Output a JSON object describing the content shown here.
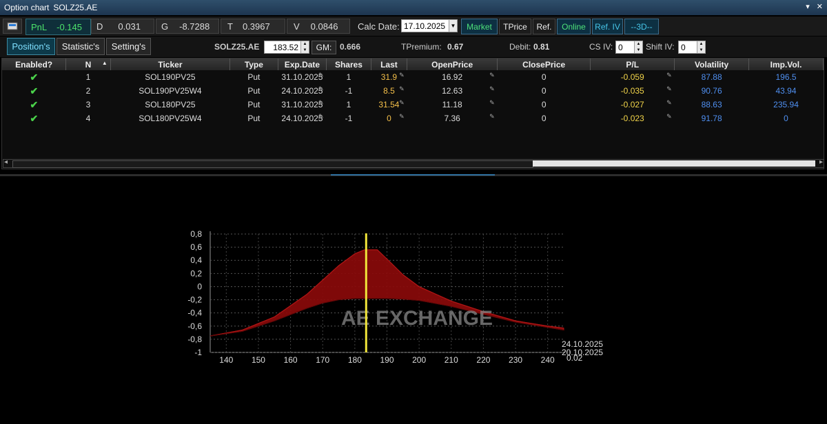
{
  "window": {
    "title": "Option chart",
    "symbol": "SOLZ25.AE",
    "pin": "▾",
    "close": "✕"
  },
  "toolbar": {
    "pnl_label": "PnL",
    "pnl_value": "-0.145",
    "greeks": [
      {
        "label": "D",
        "value": "0.031"
      },
      {
        "label": "G",
        "value": "-8.7288"
      },
      {
        "label": "T",
        "value": "0.3967"
      },
      {
        "label": "V",
        "value": "0.0846"
      }
    ],
    "calc_date_label": "Calc Date:",
    "calc_date_value": "17.10.2025",
    "buttons": [
      "Market",
      "TPrice",
      "Ref.",
      "Online",
      "Ref. IV",
      "--3D--"
    ]
  },
  "tabs": [
    "Position's",
    "Statistic's",
    "Setting's"
  ],
  "row2": {
    "symbol": "SOLZ25.AE",
    "price": "183.52",
    "gm_label": "GM:",
    "gm_value": "0.666",
    "tpremium_label": "TPremium:",
    "tpremium_value": "0.67",
    "debit_label": "Debit:",
    "debit_value": "0.81",
    "cs_iv_label": "CS IV:",
    "cs_iv_value": "0",
    "shift_iv_label": "Shift IV:",
    "shift_iv_value": "0"
  },
  "table": {
    "columns": [
      "Enabled?",
      "N",
      "Ticker",
      "Type",
      "Exp.Date",
      "Shares",
      "Last",
      "OpenPrice",
      "ClosePrice",
      "P/L",
      "Volatility",
      "Imp.Vol."
    ],
    "rows": [
      {
        "enabled": "✔",
        "n": "1",
        "ticker": "SOL190PV25",
        "type": "Put",
        "exp": "31.10.2025",
        "shares": "1",
        "last": "31.9",
        "open": "16.92",
        "close": "0",
        "pl": "-0.059",
        "vol": "87.88",
        "iv": "196.5"
      },
      {
        "enabled": "✔",
        "n": "2",
        "ticker": "SOL190PV25W4",
        "type": "Put",
        "exp": "24.10.2025",
        "shares": "-1",
        "last": "8.5",
        "open": "12.63",
        "close": "0",
        "pl": "-0.035",
        "vol": "90.76",
        "iv": "43.94"
      },
      {
        "enabled": "✔",
        "n": "3",
        "ticker": "SOL180PV25",
        "type": "Put",
        "exp": "31.10.2025",
        "shares": "1",
        "last": "31.54",
        "open": "11.18",
        "close": "0",
        "pl": "-0.027",
        "vol": "88.63",
        "iv": "235.94"
      },
      {
        "enabled": "✔",
        "n": "4",
        "ticker": "SOL180PV25W4",
        "type": "Put",
        "exp": "24.10.2025",
        "shares": "-1",
        "last": "0",
        "open": "7.36",
        "close": "0",
        "pl": "-0.023",
        "vol": "91.78",
        "iv": "0"
      }
    ]
  },
  "chart_data": {
    "type": "area",
    "watermark": "AE EXCHANGE",
    "y_ticks": [
      "0,8",
      "0,6",
      "0,4",
      "0,2",
      "0",
      "-0,2",
      "-0,4",
      "-0,6",
      "-0,8",
      "-1"
    ],
    "x_ticks": [
      "140",
      "150",
      "160",
      "170",
      "180",
      "190",
      "200",
      "210",
      "220",
      "230",
      "240"
    ],
    "depth_labels": [
      "24.10.2025",
      "…",
      "20.10.2025",
      "0.02"
    ],
    "ylim": [
      -1,
      0.8
    ],
    "xlim": [
      135,
      245
    ],
    "current_price": 183.52,
    "upper_series": {
      "x": [
        135,
        145,
        155,
        165,
        170,
        175,
        180,
        183,
        187,
        190,
        195,
        200,
        210,
        220,
        230,
        240,
        245
      ],
      "y": [
        -0.75,
        -0.66,
        -0.46,
        -0.12,
        0.1,
        0.32,
        0.5,
        0.56,
        0.56,
        0.42,
        0.18,
        0.0,
        -0.22,
        -0.38,
        -0.52,
        -0.6,
        -0.63
      ]
    },
    "lower_series": {
      "x": [
        135,
        145,
        155,
        165,
        170,
        175,
        180,
        183,
        187,
        190,
        195,
        200,
        210,
        220,
        230,
        240,
        245
      ],
      "y": [
        -0.75,
        -0.68,
        -0.52,
        -0.33,
        -0.25,
        -0.2,
        -0.18,
        -0.18,
        -0.18,
        -0.18,
        -0.19,
        -0.21,
        -0.3,
        -0.42,
        -0.54,
        -0.62,
        -0.66
      ]
    },
    "colors": {
      "fill": "#8a0a0a",
      "edge": "#b01515",
      "price_line": "#f1e63a"
    }
  }
}
